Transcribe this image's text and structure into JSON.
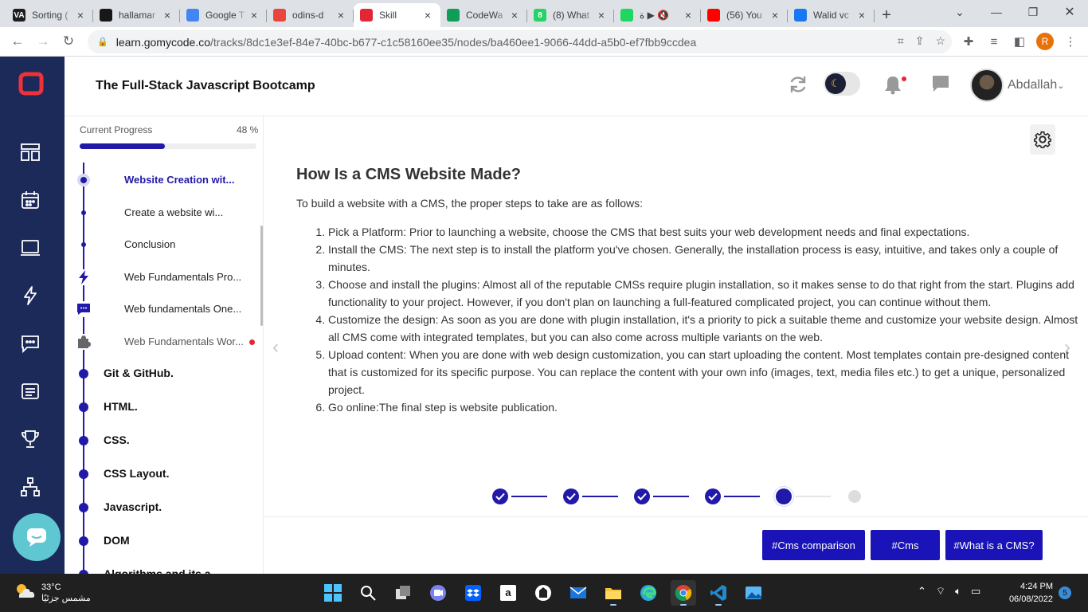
{
  "browser": {
    "tabs": [
      {
        "title": "Sorting (",
        "fav_color": "#1d1d1d",
        "fav_text": "VA",
        "active": false
      },
      {
        "title": "hallamar",
        "fav_color": "#181717",
        "fav_text": "",
        "active": false
      },
      {
        "title": "Google T",
        "fav_color": "#4285f4",
        "fav_text": "",
        "active": false
      },
      {
        "title": "odins-d",
        "fav_color": "#e8453c",
        "fav_text": "",
        "active": false
      },
      {
        "title": "Skill",
        "fav_color": "#e32636",
        "fav_text": "",
        "active": true
      },
      {
        "title": "CodeWa",
        "fav_color": "#0f9d58",
        "fav_text": "",
        "active": false
      },
      {
        "title": "(8) What",
        "fav_color": "#25d366",
        "fav_text": "8",
        "active": false
      },
      {
        "title": "ة ▶ 🔇",
        "fav_color": "#1ed760",
        "fav_text": "",
        "active": false
      },
      {
        "title": "(56) You",
        "fav_color": "#ff0000",
        "fav_text": "",
        "active": false
      },
      {
        "title": "Walid vc",
        "fav_color": "#1877f2",
        "fav_text": "",
        "active": false
      }
    ],
    "url_host": "learn.gomycode.co",
    "url_path": "/tracks/8dc1e3ef-84e7-40bc-b677-c1c58160ee35/nodes/ba460ee1-9066-44dd-a5b0-ef7fbb9ccdea",
    "profile_initial": "R"
  },
  "header": {
    "title": "The Full-Stack Javascript Bootcamp",
    "username": "Abdallah",
    "theme_icon": "moon-icon"
  },
  "sidebar": {
    "progress_label": "Current Progress",
    "progress_text": "48 %",
    "progress_value": 0.48,
    "subitems": [
      {
        "label": "Website Creation wit...",
        "state": "active",
        "icon": "ring"
      },
      {
        "label": "Create a website wi...",
        "state": "normal",
        "icon": "dot"
      },
      {
        "label": "Conclusion",
        "state": "normal",
        "icon": "dot"
      },
      {
        "label": "Web Fundamentals Pro...",
        "state": "normal",
        "icon": "lightning-icon"
      },
      {
        "label": "Web fundamentals One...",
        "state": "normal",
        "icon": "chat-icon"
      },
      {
        "label": "Web Fundamentals Wor...",
        "state": "muted",
        "icon": "puzzle-icon",
        "alert": true
      }
    ],
    "chapters": [
      "Git & GitHub.",
      "HTML.",
      "CSS.",
      "CSS Layout.",
      "Javascript.",
      "DOM",
      "Algorithms and its a..."
    ]
  },
  "lesson": {
    "title": "How Is a CMS Website Made?",
    "intro": "To build a website with a CMS, the proper steps to take are as follows:",
    "steps": [
      "Pick a Platform: Prior to launching a website, choose the CMS that best suits your web development needs and final expectations.",
      "Install the CMS: The next step is to install the platform you've chosen. Generally, the installation process is easy, intuitive, and takes only a couple of minutes.",
      "Choose and install the plugins: Almost all of the reputable CMSs require plugin installation, so it makes sense to do that right from the start. Plugins add functionality to your project. However, if you don't plan on launching a full-featured complicated project, you can continue without them.",
      "Customize the design: As soon as you are done with plugin installation, it's a priority to pick a suitable theme and customize your website design. Almost all CMS come with integrated templates, but you can also come across multiple variants on the web.",
      "Upload content: When you are done with web design customization, you can start uploading the content. Most templates contain pre-designed content that is customized for its specific purpose. You can replace the content with your own info (images, text, media files etc.) to get a unique, personalized project.",
      "Go online:The final step is website publication."
    ],
    "pagination": {
      "total": 6,
      "completed": 4,
      "current": 5
    },
    "tags": [
      "#Cms comparison",
      "#Cms",
      "#What is a CMS?"
    ]
  },
  "taskbar": {
    "temperature": "33°C",
    "weather_text": "مشمس جزئيًا",
    "time": "4:24 PM",
    "date": "06/08/2022",
    "notifications": "5"
  },
  "colors": {
    "brand_navy": "#1c2a59",
    "primary": "#2119a8",
    "tag_button": "#1a13b8",
    "alert_red": "#e32636",
    "logo_red": "#f0313a",
    "chat_teal": "#5ec7d2"
  }
}
